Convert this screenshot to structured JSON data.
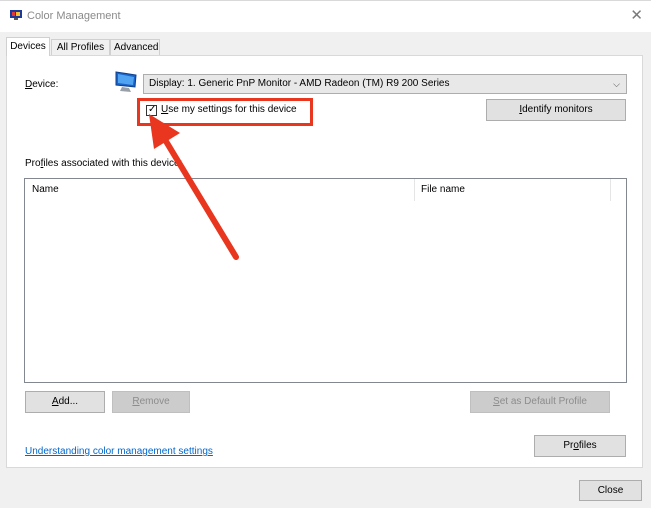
{
  "window": {
    "title": "Color Management",
    "close_glyph": "✕"
  },
  "tabs": [
    {
      "label": "Devices",
      "active": true
    },
    {
      "label": "All Profiles",
      "active": false
    },
    {
      "label": "Advanced",
      "active": false
    }
  ],
  "device": {
    "label_prefix": "D",
    "label_rest": "evice:",
    "selected": "Display: 1. Generic PnP Monitor - AMD Radeon (TM) R9 200 Series",
    "chevron": "⌵",
    "icon": "monitor-icon"
  },
  "use_settings": {
    "label_prefix": "U",
    "label_rest": "se my settings for this device",
    "checked": true,
    "check_glyph": "✓"
  },
  "identify_button": {
    "prefix": "I",
    "rest": "dentify monitors"
  },
  "profiles_section": {
    "label_a": "Pro",
    "label_u": "f",
    "label_b": "iles associated with this device:",
    "columns": [
      "Name",
      "File name"
    ]
  },
  "buttons": {
    "add": {
      "prefix": "A",
      "rest": "dd..."
    },
    "remove": {
      "prefix": "R",
      "rest": "emove"
    },
    "set_default": {
      "prefix": "S",
      "rest": "et as Default Profile"
    },
    "profiles": {
      "a": "Pr",
      "u": "o",
      "b": "files"
    },
    "close": "Close"
  },
  "link": "Understanding color management settings",
  "colors": {
    "highlight": "#e8361f",
    "link": "#0066cc"
  }
}
